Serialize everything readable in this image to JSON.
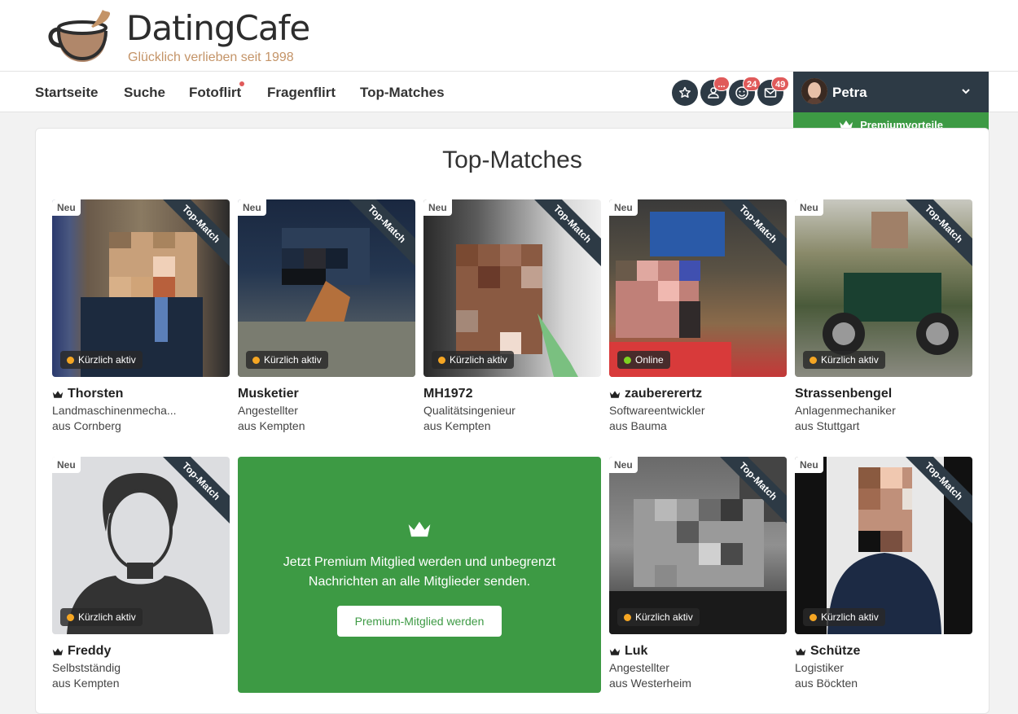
{
  "brand": {
    "name": "DatingCafe",
    "tagline": "Glücklich verlieben seit 1998"
  },
  "nav": {
    "items": [
      "Startseite",
      "Suche",
      "Fotoflirt",
      "Fragenflirt",
      "Top-Matches"
    ]
  },
  "icons": {
    "favorites": "star-icon",
    "visitors": "user-icon",
    "smiles": "smiley-icon",
    "messages": "mail-icon"
  },
  "badges": {
    "visitors": "...",
    "smiles": "24",
    "messages": "49"
  },
  "user": {
    "name": "Petra",
    "premium_label": "Premiumvorteile"
  },
  "page": {
    "title": "Top-Matches"
  },
  "labels": {
    "new": "Neu",
    "ribbon": "Top-Match"
  },
  "colors": {
    "accent_green": "#3d9a44",
    "dark": "#2d3a45",
    "badge_red": "#e05a5a",
    "status_active": "#f5a623",
    "status_online": "#7ed321"
  },
  "cards": [
    {
      "name": "Thorsten",
      "job": "Landmaschinenmecha...",
      "city": "aus Cornberg",
      "status": "Kürzlich aktiv",
      "premium": true
    },
    {
      "name": "Musketier",
      "job": "Angestellter",
      "city": "aus Kempten",
      "status": "Kürzlich aktiv",
      "premium": false
    },
    {
      "name": "MH1972",
      "job": "Qualitätsingenieur",
      "city": "aus Kempten",
      "status": "Kürzlich aktiv",
      "premium": false
    },
    {
      "name": "zaubererertz",
      "job": "Softwareentwickler",
      "city": "aus Bauma",
      "status": "Online",
      "premium": true
    },
    {
      "name": "Strassenbengel",
      "job": "Anlagenmechaniker",
      "city": "aus Stuttgart",
      "status": "Kürzlich aktiv",
      "premium": false
    },
    {
      "name": "Freddy",
      "job": "Selbstständig",
      "city": "aus Kempten",
      "status": "Kürzlich aktiv",
      "premium": true
    },
    {
      "name": "Luk",
      "job": "Angestellter",
      "city": "aus Westerheim",
      "status": "Kürzlich aktiv",
      "premium": true
    },
    {
      "name": "Schütze",
      "job": "Logistiker",
      "city": "aus Böckten",
      "status": "Kürzlich aktiv",
      "premium": true
    }
  ],
  "promo": {
    "text": "Jetzt Premium Mitglied werden und unbegrenzt Nachrichten an alle Mitglieder senden.",
    "button": "Premium-Mitglied werden"
  }
}
